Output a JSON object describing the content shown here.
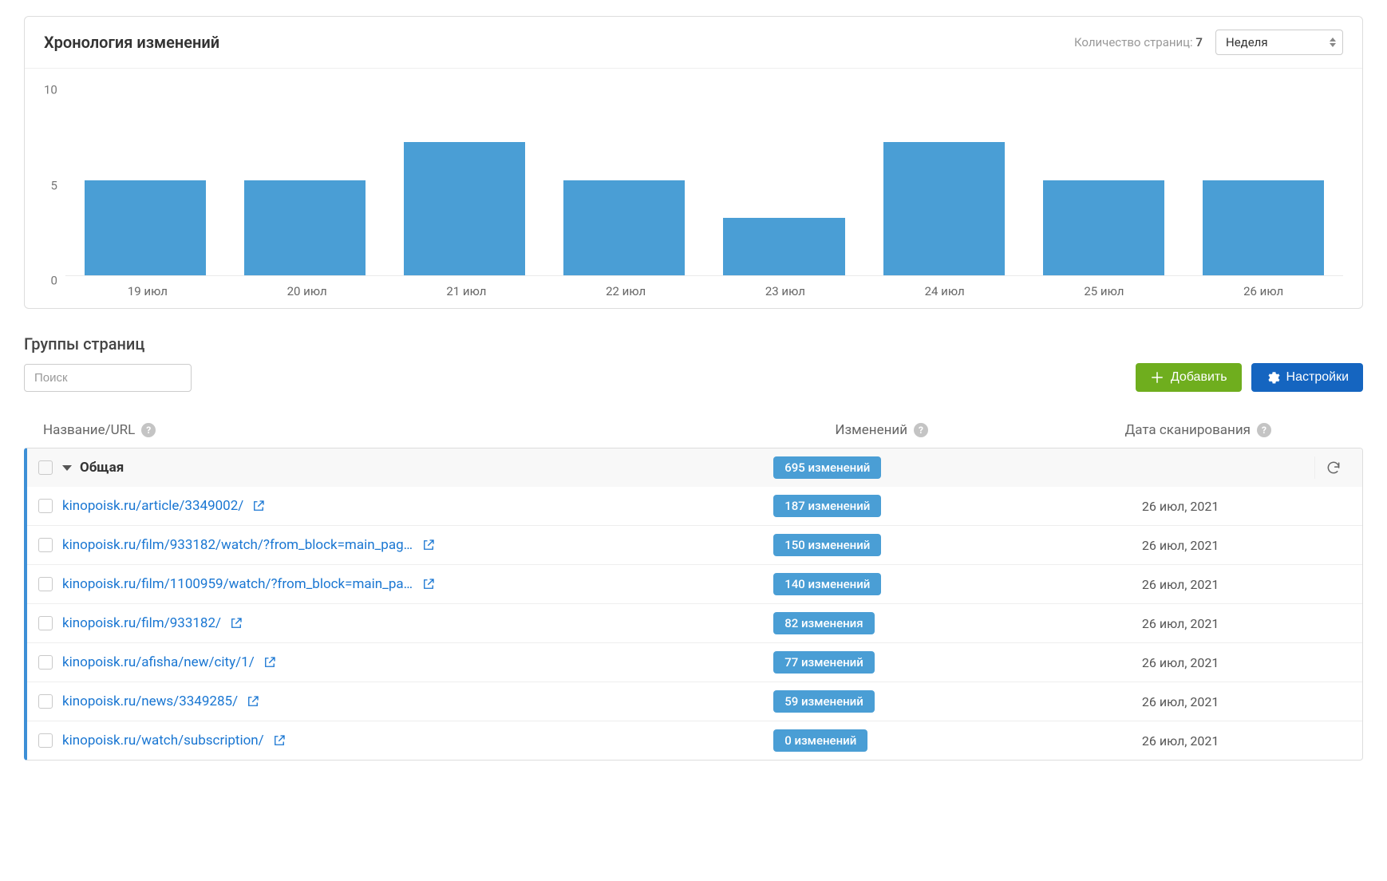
{
  "chart_header": {
    "title": "Хронология изменений",
    "page_count_label": "Количество страниц:",
    "page_count_value": "7",
    "period_selected": "Неделя"
  },
  "chart_data": {
    "type": "bar",
    "categories": [
      "19 июл",
      "20 июл",
      "21 июл",
      "22 июл",
      "23 июл",
      "24 июл",
      "25 июл",
      "26 июл"
    ],
    "values": [
      5,
      5,
      7,
      5,
      3,
      7,
      5,
      5
    ],
    "ylim": [
      0,
      10
    ],
    "yticks": [
      10,
      5,
      0
    ],
    "title": "Хронология изменений",
    "xlabel": "",
    "ylabel": ""
  },
  "groups": {
    "title": "Группы страниц",
    "search_placeholder": "Поиск",
    "add_label": "Добавить",
    "settings_label": "Настройки"
  },
  "table": {
    "col_name": "Название/URL",
    "col_changes": "Изменений",
    "col_date": "Дата сканирования",
    "group_row": {
      "name": "Общая",
      "changes": "695 изменений"
    },
    "rows": [
      {
        "url": "kinopoisk.ru/article/3349002/",
        "changes": "187 изменений",
        "date": "26 июл, 2021"
      },
      {
        "url": "kinopoisk.ru/film/933182/watch/?from_block=main_pag...",
        "changes": "150 изменений",
        "date": "26 июл, 2021"
      },
      {
        "url": "kinopoisk.ru/film/1100959/watch/?from_block=main_pa...",
        "changes": "140 изменений",
        "date": "26 июл, 2021"
      },
      {
        "url": "kinopoisk.ru/film/933182/",
        "changes": "82 изменения",
        "date": "26 июл, 2021"
      },
      {
        "url": "kinopoisk.ru/afisha/new/city/1/",
        "changes": "77 изменений",
        "date": "26 июл, 2021"
      },
      {
        "url": "kinopoisk.ru/news/3349285/",
        "changes": "59 изменений",
        "date": "26 июл, 2021"
      },
      {
        "url": "kinopoisk.ru/watch/subscription/",
        "changes": "0 изменений",
        "date": "26 июл, 2021"
      }
    ]
  }
}
